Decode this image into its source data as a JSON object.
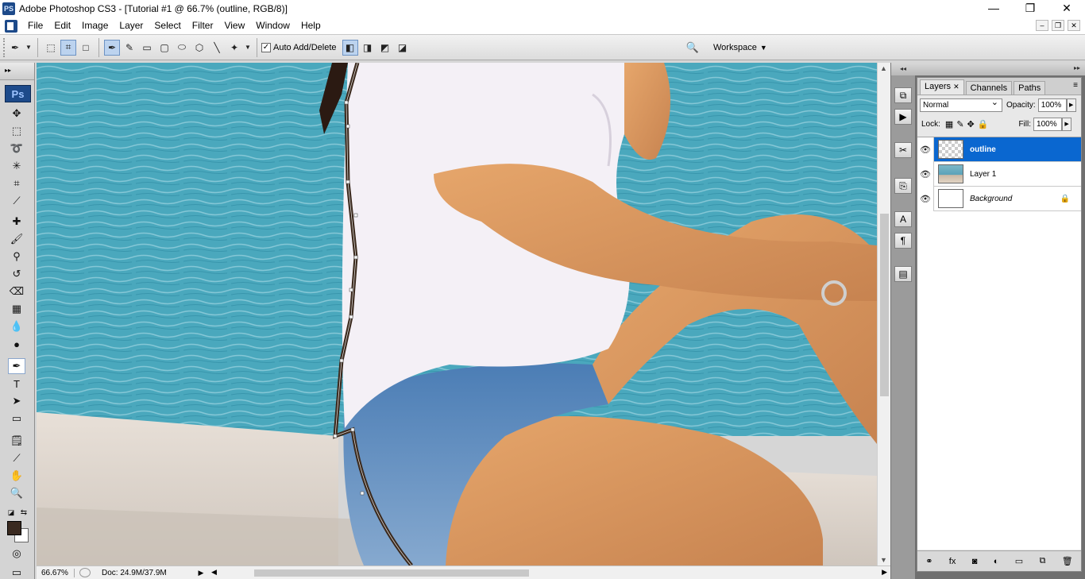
{
  "window": {
    "app_icon": "PS",
    "title": "Adobe Photoshop CS3 - [Tutorial #1 @ 66.7% (outline, RGB/8)]",
    "controls": [
      "—",
      "❐",
      "✕"
    ]
  },
  "menu": {
    "items": [
      "File",
      "Edit",
      "Image",
      "Layer",
      "Select",
      "Filter",
      "View",
      "Window",
      "Help"
    ],
    "doc_controls": [
      "–",
      "❐",
      "✕"
    ]
  },
  "options_bar": {
    "auto_add_delete_label": "Auto Add/Delete",
    "auto_add_delete_checked": true,
    "workspace_label": "Workspace"
  },
  "toolbox": {
    "logo": "Ps",
    "active_tool": "pen-tool",
    "foreground_color": "#3a2a20",
    "background_color": "#ffffff"
  },
  "status": {
    "zoom": "66.67%",
    "doc_size": "Doc: 24.9M/37.9M"
  },
  "layers_panel": {
    "tabs": [
      "Layers",
      "Channels",
      "Paths"
    ],
    "active_tab": "Layers",
    "blend_mode": "Normal",
    "opacity_label": "Opacity:",
    "opacity": "100%",
    "lock_label": "Lock:",
    "fill_label": "Fill:",
    "fill": "100%",
    "layers": [
      {
        "name": "outline",
        "selected": true,
        "visible": true,
        "locked": false
      },
      {
        "name": "Layer 1",
        "selected": false,
        "visible": true,
        "locked": false
      },
      {
        "name": "Background",
        "selected": false,
        "visible": true,
        "locked": true
      }
    ]
  },
  "colors": {
    "selection_blue": "#0a67d0",
    "outline_stroke": "#3b2a1e"
  }
}
